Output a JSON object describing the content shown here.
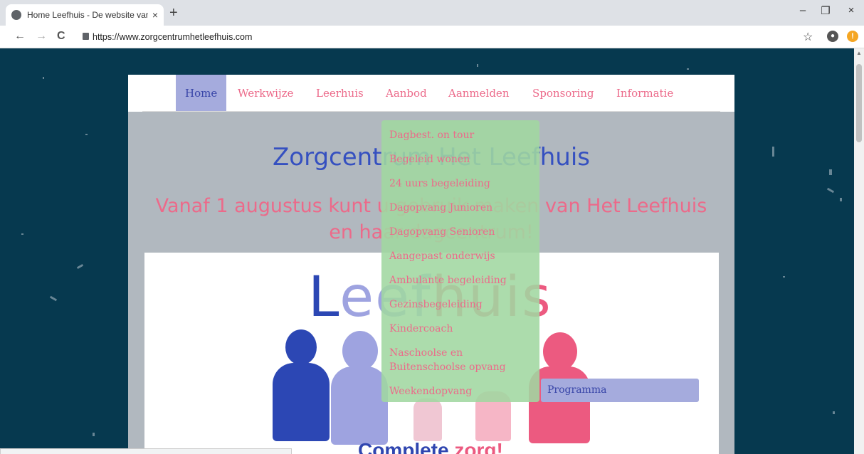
{
  "browser": {
    "tab_title": "Home Leefhuis - De website van",
    "tab_close": "×",
    "new_tab": "+",
    "url": "https://www.zorgcentrumhetleefhuis.com",
    "back": "←",
    "forward": "→",
    "reload": "C",
    "star": "☆",
    "minimize": "–",
    "restore": "❐",
    "close": "×",
    "alert_badge": "!"
  },
  "nav": {
    "items": [
      {
        "label": "Home",
        "active": true
      },
      {
        "label": "Werkwijze"
      },
      {
        "label": "Leerhuis"
      },
      {
        "label": "Aanbod"
      },
      {
        "label": "Aanmelden"
      },
      {
        "label": "Sponsoring"
      },
      {
        "label": "Informatie"
      }
    ]
  },
  "header": {
    "title": "Zorgcentrum Het Leefhuis",
    "notice_line1": "Vanaf 1 augustus kunt u gebruik maken van Het Leefhuis",
    "notice_line2": "en haar dagcentrum!"
  },
  "hero": {
    "logo_text": "Leefhuis",
    "tagline_part1": "Complete",
    "tagline_part2": "zorg!"
  },
  "dropdown": {
    "items": [
      "Dagbest. on tour",
      "Begeleid wonen",
      "24 uurs begeleiding",
      "Dagopvang Junioren",
      "Dagopvang Senioren",
      "Aangepast onderwijs",
      "Ambulante begeleiding",
      "Gezinsbegeleiding",
      "Kindercoach",
      "Naschoolse en Buitenschoolse opvang",
      "Weekendopvang"
    ],
    "submenu_item": "Programma"
  },
  "colors": {
    "background": "#06394f",
    "accent_pink": "#ec6a8a",
    "accent_blue": "#3550c0",
    "active_nav": "#a5abdd",
    "dropdown_green": "#a0d7a0"
  }
}
